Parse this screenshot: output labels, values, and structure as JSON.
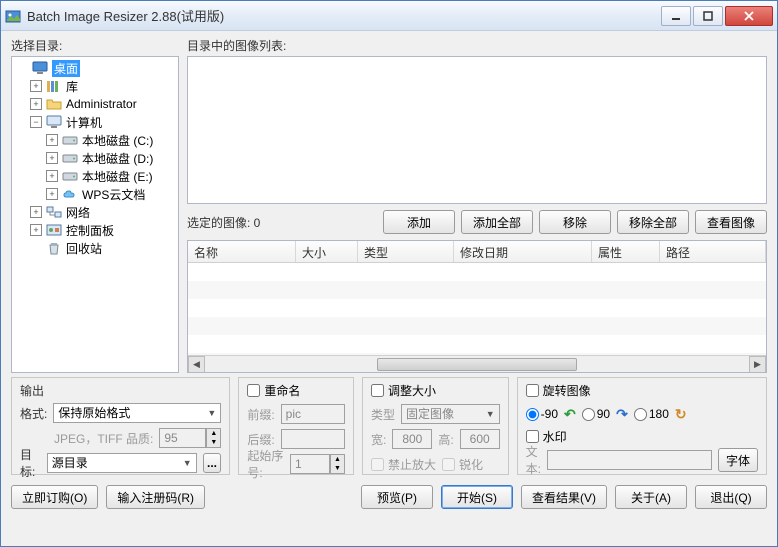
{
  "window": {
    "title": "Batch Image Resizer 2.88(试用版)"
  },
  "left": {
    "label": "选择目录:",
    "tree": {
      "desktop": "桌面",
      "library": "库",
      "admin": "Administrator",
      "computer": "计算机",
      "drive_c": "本地磁盘 (C:)",
      "drive_d": "本地磁盘 (D:)",
      "drive_e": "本地磁盘 (E:)",
      "wps": "WPS云文档",
      "network": "网络",
      "control": "控制面板",
      "recycle": "回收站"
    }
  },
  "right": {
    "list_label": "目录中的图像列表:",
    "selected_label": "选定的图像: 0",
    "buttons": {
      "add": "添加",
      "add_all": "添加全部",
      "remove": "移除",
      "remove_all": "移除全部",
      "view": "查看图像"
    },
    "columns": {
      "name": "名称",
      "size": "大小",
      "type": "类型",
      "modified": "修改日期",
      "attr": "属性",
      "path": "路径"
    }
  },
  "output": {
    "title": "输出",
    "format_lbl": "格式:",
    "format_val": "保持原始格式",
    "jpeg_lbl": "JPEG，TIFF 品质:",
    "jpeg_val": "95",
    "target_lbl": "目标:",
    "target_val": "源目录",
    "browse": "..."
  },
  "rename": {
    "title": "重命名",
    "prefix_lbl": "前缀:",
    "prefix_val": "pic",
    "suffix_lbl": "后缀:",
    "suffix_val": "",
    "start_lbl": "起始序号:",
    "start_val": "1"
  },
  "resize": {
    "title": "调整大小",
    "type_lbl": "类型",
    "type_val": "固定图像",
    "w_lbl": "宽:",
    "w_val": "800",
    "h_lbl": "高:",
    "h_val": "600",
    "no_enlarge": "禁止放大",
    "sharpen": "锐化"
  },
  "rotate": {
    "title": "旋转图像",
    "n90": "-90",
    "p90": "90",
    "p180": "180",
    "watermark": "水印",
    "text_lbl": "文本:",
    "font_btn": "字体"
  },
  "bottom": {
    "order": "立即订购(O)",
    "reg": "输入注册码(R)",
    "preview": "预览(P)",
    "start": "开始(S)",
    "result": "查看结果(V)",
    "about": "关于(A)",
    "exit": "退出(Q)"
  }
}
